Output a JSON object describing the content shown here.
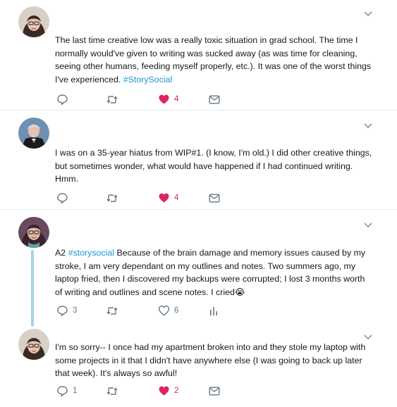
{
  "tweets": [
    {
      "text_parts": [
        "The last time creative low was a really toxic situation in grad school. The time I normally would've given to writing was sucked away (as was time for cleaning, seeing other humans, feeding myself properly, etc.). It was one of the worst things I've experienced. ",
        "#StorySocial",
        ""
      ],
      "reply_count": "",
      "retweet_count": "",
      "like_count": "4",
      "liked": true
    },
    {
      "text_parts": [
        "I was on a 35-year hiatus from WIP#1. (I know, I'm old.) I did other creative things, but sometimes wonder, what would have happened if I had continued writing. Hmm.",
        "",
        ""
      ],
      "reply_count": "",
      "retweet_count": "",
      "like_count": "4",
      "liked": true
    },
    {
      "text_parts": [
        "A2 ",
        "#storysocial",
        " Because of the brain damage and memory issues caused by my stroke, I am very dependant on my outlines and notes. Two summers ago, my laptop fried, then I discovered my backups were corrupted; I lost 3 months worth of writing and outlines and scene notes. I cried😭"
      ],
      "reply_count": "3",
      "retweet_count": "",
      "like_count": "6",
      "liked": false
    },
    {
      "text_parts": [
        "I'm so sorry-- I once had my apartment broken into and they stole my laptop with some projects in it that I didn't have anywhere else (I was going to back up later that week). It's always so awful!",
        "",
        ""
      ],
      "reply_count": "1",
      "retweet_count": "",
      "like_count": "2",
      "liked": true
    }
  ],
  "icons": {
    "reply": "reply-icon",
    "retweet": "retweet-icon",
    "like": "heart-icon",
    "message": "envelope-icon",
    "analytics": "analytics-icon",
    "menu": "chevron-down-icon"
  },
  "colors": {
    "icon_gray": "#657786",
    "like_red": "#e0245e",
    "hashtag_blue": "#1b95e0",
    "thread_line": "#a8d1ea",
    "divider": "#e6ecf0"
  }
}
